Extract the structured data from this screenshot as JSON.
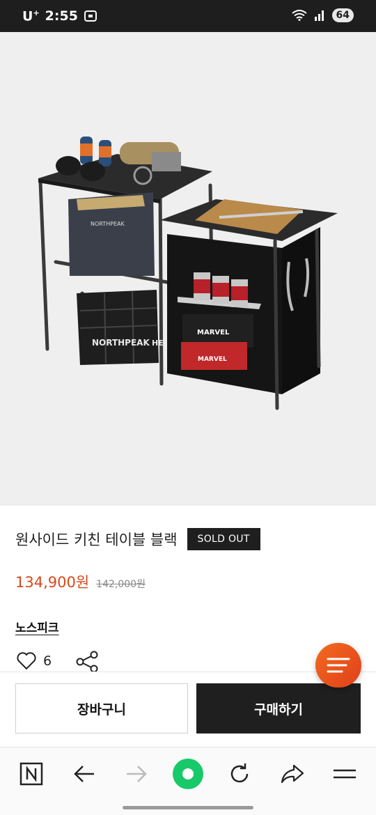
{
  "status_bar": {
    "carrier": "U",
    "carrier_sup": "+",
    "time": "2:55",
    "battery": "64"
  },
  "product": {
    "title": "원사이드 키친 테이블 블랙",
    "badge": "SOLD OUT",
    "price": "134,900원",
    "original_price": "142,000원",
    "brand": "노스피크",
    "like_count": "6"
  },
  "actions": {
    "cart_label": "장바구니",
    "buy_label": "구매하기"
  },
  "image_text": {
    "bag_brand": "NORTHPEAK",
    "crate_brand": "NORTHPEAK",
    "crate_brand_2": "HE",
    "box_label": "MARVEL",
    "box_label_2": "MARVEL"
  },
  "colors": {
    "price": "#d9481c",
    "buy_button": "#1f1f1f",
    "fab": "#e8501c",
    "browser_green": "#18c96a"
  },
  "icons": {
    "like": "heart-icon",
    "share": "share-icon",
    "fab": "menu-lines-icon",
    "nav": [
      "naver-n-icon",
      "back-arrow-icon",
      "forward-arrow-icon",
      "green-dot-home-icon",
      "refresh-icon",
      "share-forward-icon",
      "hamburger-menu-icon"
    ]
  }
}
